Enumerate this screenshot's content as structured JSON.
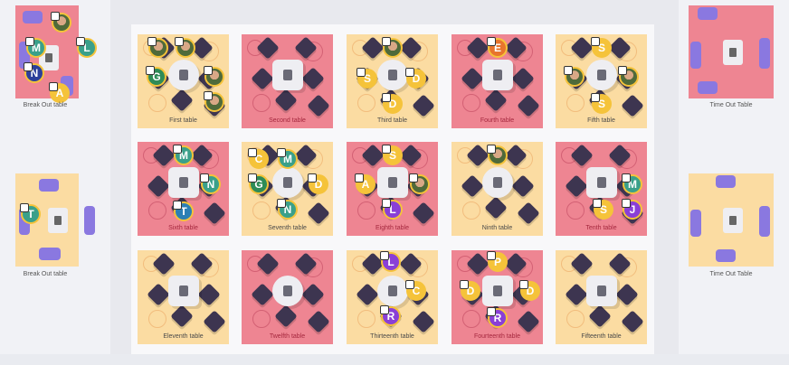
{
  "colors": {
    "yellow": "#fbdca2",
    "red": "#ee8592",
    "accent": "#f5c33a"
  },
  "tables": [
    {
      "label": "First table",
      "color": "yellow"
    },
    {
      "label": "Second table",
      "color": "red"
    },
    {
      "label": "Third table",
      "color": "yellow"
    },
    {
      "label": "Fourth table",
      "color": "red"
    },
    {
      "label": "Fifth table",
      "color": "yellow"
    },
    {
      "label": "Sixth table",
      "color": "red"
    },
    {
      "label": "Seventh table",
      "color": "yellow"
    },
    {
      "label": "Eighth table",
      "color": "red"
    },
    {
      "label": "Ninth table",
      "color": "yellow"
    },
    {
      "label": "Tenth table",
      "color": "red"
    },
    {
      "label": "Eleventh table",
      "color": "yellow"
    },
    {
      "label": "Twelfth table",
      "color": "red"
    },
    {
      "label": "Thirteenth table",
      "color": "yellow"
    },
    {
      "label": "Fourteenth table",
      "color": "red"
    },
    {
      "label": "Fifteenth table",
      "color": "yellow"
    }
  ],
  "side": {
    "left_top": "Break Out table",
    "left_bottom": "Break Out table",
    "right_top": "Time Out Table",
    "right_bottom": "Time Out Table"
  },
  "avatars": {
    "t1": [
      "",
      "",
      "G",
      "",
      ""
    ],
    "t3": [
      "",
      "S",
      "D",
      "D"
    ],
    "t4": [
      "E"
    ],
    "t5": [
      "S",
      "",
      "",
      "S"
    ],
    "t6": [
      "M",
      "N",
      "T"
    ],
    "t7": [
      "C",
      "M",
      "G",
      "D",
      "N"
    ],
    "t8": [
      "S",
      "A",
      "",
      "L"
    ],
    "t9": [
      ""
    ],
    "t10": [
      "M",
      "S",
      "J"
    ],
    "t13": [
      "L",
      "C",
      "R"
    ],
    "t14": [
      "P",
      "D",
      "D",
      "R"
    ],
    "bo1": [
      "",
      "M",
      "L",
      "N",
      "A"
    ],
    "bo2": [
      "T"
    ]
  },
  "avatar_colors": {
    "G": "#2e8b57",
    "S": "#f5c33a",
    "D": "#f5c33a",
    "E": "#e8742c",
    "M": "#3aa08a",
    "N": "#3aa08a",
    "T": "#2b7fb5",
    "C": "#f5c33a",
    "A": "#f5c33a",
    "L": "#8a3fd6",
    "J": "#8a3fd6",
    "P": "#f5c33a",
    "R": "#8a3fd6"
  }
}
